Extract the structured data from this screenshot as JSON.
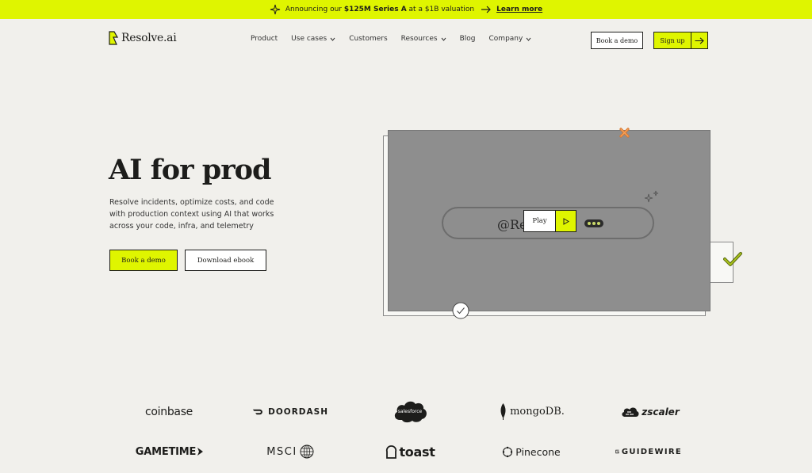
{
  "banner": {
    "prefix": "Announcing our",
    "highlight": "$125M Series A",
    "suffix": "at a $1B valuation",
    "link": "Learn more"
  },
  "nav": {
    "brand": "Resolve.ai",
    "items": [
      {
        "label": "Product",
        "dropdown": false
      },
      {
        "label": "Use cases",
        "dropdown": true
      },
      {
        "label": "Customers",
        "dropdown": false
      },
      {
        "label": "Resources",
        "dropdown": true
      },
      {
        "label": "Blog",
        "dropdown": false
      },
      {
        "label": "Company",
        "dropdown": true
      }
    ],
    "book_demo": "Book a demo",
    "sign_up": "Sign up"
  },
  "hero": {
    "title": "AI for prod",
    "subtitle": "Resolve incidents, optimize costs, and code with production context using AI that works across your code, infra, and telemetry",
    "cta_primary": "Book a demo",
    "cta_secondary": "Download ebook"
  },
  "video": {
    "pill_text": "@Re        I",
    "play_label": "Play"
  },
  "customers": {
    "logos": [
      "coinbase",
      "DOORDASH",
      "salesforce",
      "mongoDB.",
      "zscaler",
      "GAMETIME",
      "MSCI",
      "toast",
      "Pinecone",
      "GUIDEWIRE"
    ]
  },
  "colors": {
    "accent": "#dff500",
    "background": "#f1f0ec",
    "ink": "#1d1d1b"
  }
}
